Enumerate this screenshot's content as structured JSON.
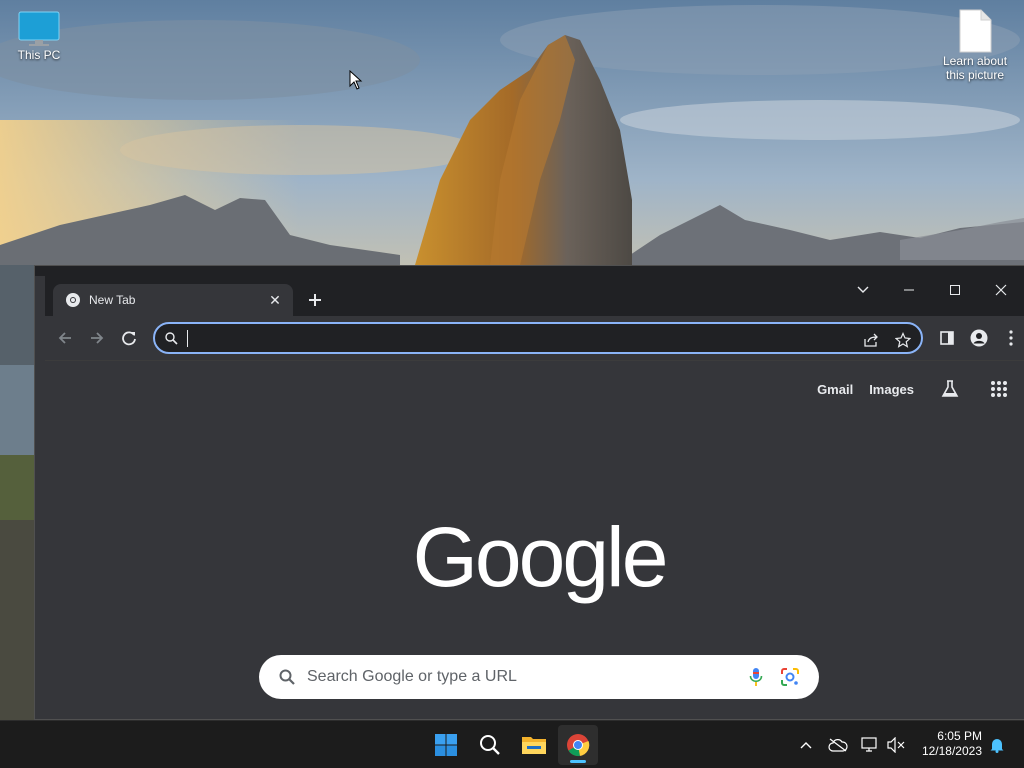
{
  "desktop": {
    "icons": [
      {
        "label": "This PC",
        "icon": "monitor-icon"
      },
      {
        "label": "Learn about\nthis picture",
        "icon": "document-icon"
      }
    ]
  },
  "browser": {
    "tab": {
      "title": "New Tab",
      "favicon": "chrome-icon"
    },
    "omnibox": {
      "value": "",
      "placeholder": ""
    },
    "top_links": {
      "gmail": "Gmail",
      "images": "Images"
    },
    "logo": "Google",
    "search": {
      "placeholder": "Search Google or type a URL"
    }
  },
  "taskbar": {
    "apps": [
      "start-icon",
      "search-icon",
      "file-explorer-icon",
      "chrome-icon"
    ],
    "active_app": "chrome-icon",
    "clock": {
      "time": "6:05 PM",
      "date": "12/18/2023"
    }
  },
  "colors": {
    "accent": "#8ab4f8",
    "taskbar_indicator": "#4cc2ff",
    "browser_bg": "#35363a",
    "titlebar_bg": "#202124"
  }
}
